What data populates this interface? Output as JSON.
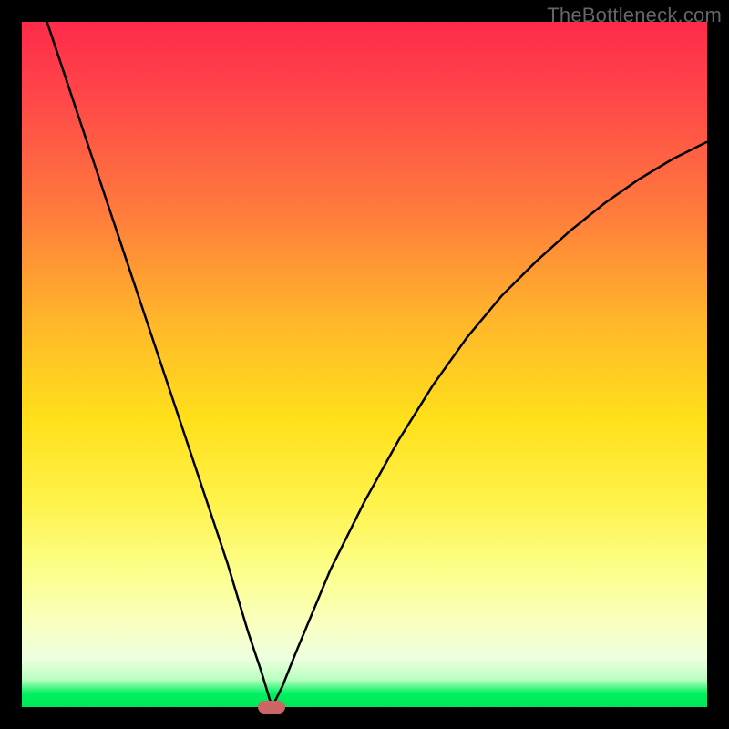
{
  "watermark": "TheBottleneck.com",
  "chart_data": {
    "type": "line",
    "title": "",
    "xlabel": "",
    "ylabel": "",
    "xlim": [
      0,
      100
    ],
    "ylim": [
      0,
      100
    ],
    "series": [
      {
        "name": "bottleneck-curve",
        "x": [
          0,
          5,
          10,
          15,
          20,
          25,
          30,
          33,
          35,
          36.5,
          38,
          40,
          45,
          50,
          55,
          60,
          65,
          70,
          75,
          80,
          85,
          90,
          95,
          100
        ],
        "y": [
          111,
          96,
          81,
          66,
          51,
          36,
          21,
          11,
          5,
          0,
          3,
          8,
          20,
          30,
          39,
          47,
          54,
          60,
          65,
          69.5,
          73.5,
          77,
          80,
          82.5
        ]
      }
    ],
    "marker": {
      "x": 36.5,
      "y": 0
    },
    "gradient_colors": {
      "top": "#ff2a4a",
      "mid": "#ffe01a",
      "bottom": "#00e858"
    },
    "curve_color": "#000000",
    "marker_color": "#cc6666"
  }
}
